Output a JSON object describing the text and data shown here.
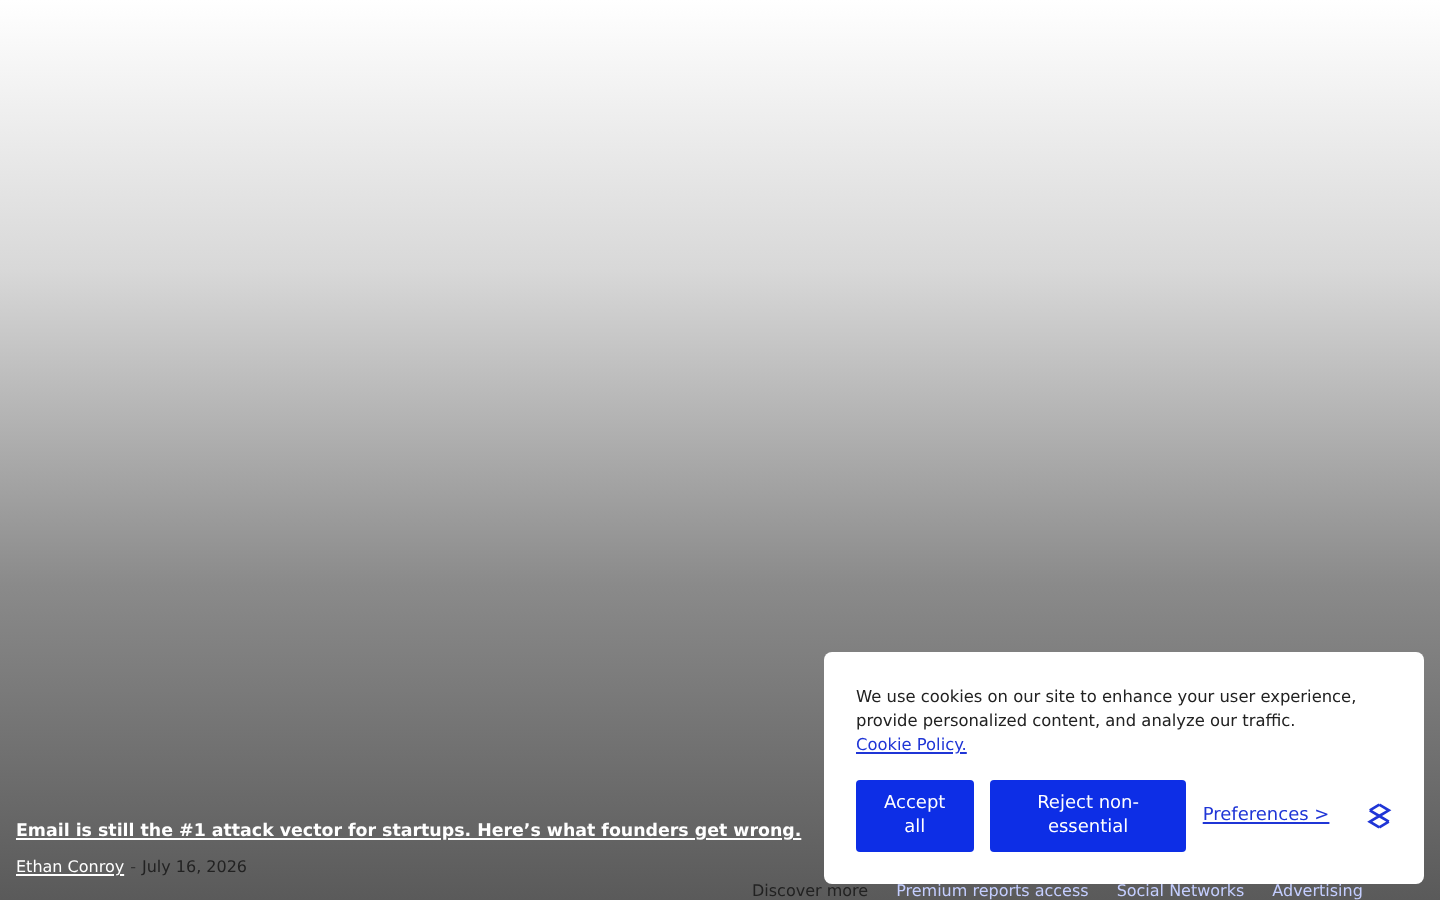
{
  "article": {
    "headline": "Email is still the #1 attack vector for startups. Here’s what founders get wrong.",
    "author": "Ethan Conroy",
    "separator": "-",
    "date": "July 16, 2026"
  },
  "discover": {
    "label": "Discover more",
    "tags": [
      "Premium reports access",
      "Social Networks",
      "Advertising"
    ]
  },
  "cookie_banner": {
    "message": "We use cookies on our site to enhance your user experience, provide personalized content, and analyze our traffic.",
    "policy_link": "Cookie Policy.",
    "buttons": [
      "Accept all",
      "Reject non-essential"
    ],
    "preferences": "Preferences >"
  }
}
